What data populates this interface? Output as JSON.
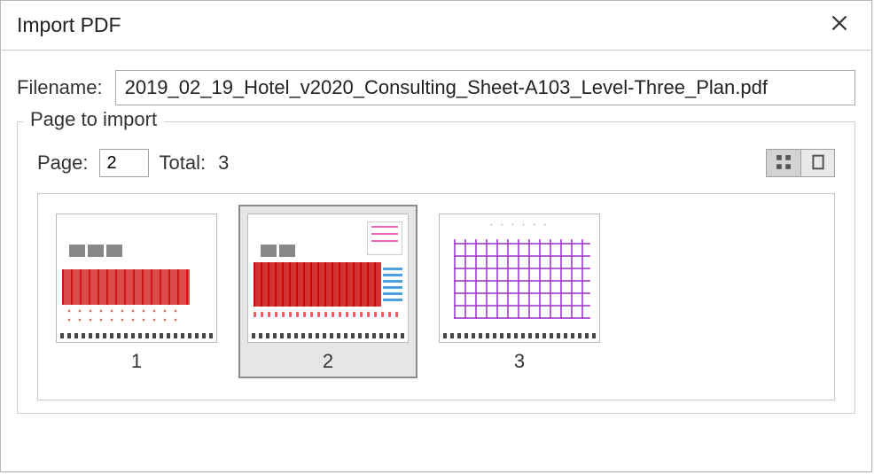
{
  "window": {
    "title": "Import PDF"
  },
  "filename": {
    "label": "Filename:",
    "value": "2019_02_19_Hotel_v2020_Consulting_Sheet-A103_Level-Three_Plan.pdf"
  },
  "group": {
    "legend": "Page to import"
  },
  "page": {
    "label": "Page:",
    "value": "2",
    "total_label": "Total:",
    "total_value": "3"
  },
  "view": {
    "mode": "grid"
  },
  "thumbnails": {
    "selected_index": 1,
    "items": [
      {
        "num": "1"
      },
      {
        "num": "2"
      },
      {
        "num": "3"
      }
    ]
  }
}
